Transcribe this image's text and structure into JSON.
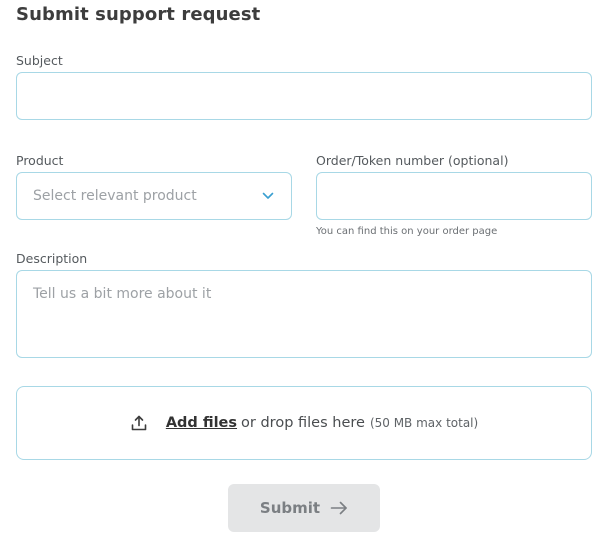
{
  "form": {
    "title": "Submit support request",
    "subject": {
      "label": "Subject",
      "value": "",
      "placeholder": ""
    },
    "product": {
      "label": "Product",
      "selected": "Select relevant product"
    },
    "order": {
      "label": "Order/Token number (optional)",
      "value": "",
      "placeholder": "",
      "hint": "You can find this on your order page"
    },
    "description": {
      "label": "Description",
      "value": "",
      "placeholder": "Tell us a bit more about it"
    },
    "upload": {
      "link_label": "Add files",
      "text": "or drop files here",
      "note": "(50 MB max total)"
    },
    "submit_label": "Submit"
  },
  "icons": {
    "chevron": "chevron-down-icon",
    "upload": "upload-icon",
    "arrow": "arrow-right-icon"
  },
  "colors": {
    "field_border": "#a8d8e6",
    "chevron": "#3a9fd1",
    "button_bg": "#e4e5e6",
    "button_text": "#7b7f83"
  }
}
